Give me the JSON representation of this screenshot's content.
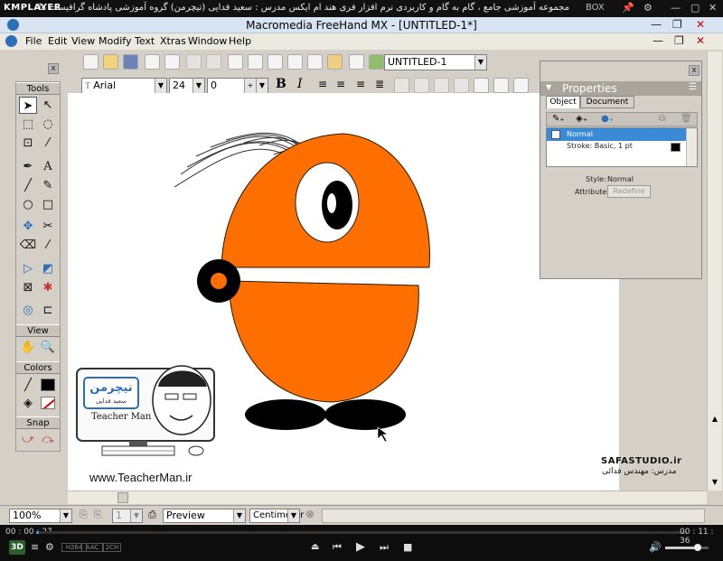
{
  "player": {
    "brand": "KMPLAYER",
    "title": "مجموعه آموزشی جامع ، گام به گام و کاربردی نرم افزار فری هند ام ایکس   مدرس : سعید فدایی (تیچرمن) گروه آموزشی پادشاه گرافیست ها",
    "box_label": "BOX",
    "time_elapsed": "00 : 00 : 27",
    "time_total": "00 : 11 : 36",
    "progress_percent": 0.4,
    "volume_percent": 75,
    "mode_label": "3D",
    "codec_labels": [
      "H264",
      "AAC",
      "2CH"
    ]
  },
  "app": {
    "title": "Macromedia FreeHand MX - [UNTITLED-1*]",
    "menu": [
      "File",
      "Edit",
      "View",
      "Modify",
      "Text",
      "Xtras",
      "Window",
      "Help"
    ],
    "document_name": "UNTITLED-1"
  },
  "text_toolbar": {
    "font": "Arial",
    "size": "24",
    "tracking": "0"
  },
  "toolbox": {
    "sections": [
      "Tools",
      "View",
      "Colors",
      "Snap"
    ],
    "close_label": "x"
  },
  "properties": {
    "title": "Properties",
    "tabs": [
      "Object",
      "Document"
    ],
    "items": [
      "Normal",
      "Stroke: Basic, 1 pt"
    ],
    "style_label": "Style:",
    "style_value": "Normal",
    "attributes_label": "Attributes:",
    "redefine_label": "Redefine",
    "close_label": "x"
  },
  "status": {
    "zoom": "100%",
    "page": "1",
    "view": "Preview",
    "units": "Centimeter"
  },
  "overlay": {
    "teacherman_url": "www.TeacherMan.ir",
    "teacherman_en": "Teacher Man",
    "teacherman_fa": "تیچرمن",
    "teacherman_sub": "سعید فدایی",
    "safa_name": "SAFASTUDIO.ir",
    "safa_teacher": "مدرس: مهندس فدائی"
  }
}
